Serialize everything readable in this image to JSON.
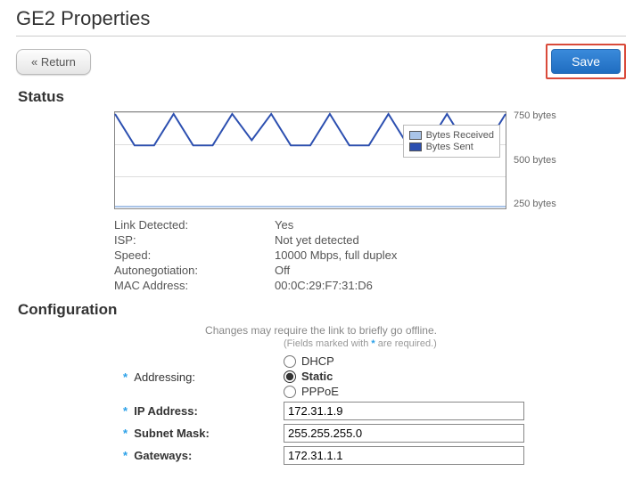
{
  "page": {
    "title": "GE2 Properties"
  },
  "toolbar": {
    "return_label": "« Return",
    "save_label": "Save"
  },
  "sections": {
    "status": "Status",
    "configuration": "Configuration"
  },
  "status": {
    "link_detected": {
      "label": "Link Detected:",
      "value": "Yes"
    },
    "isp": {
      "label": "ISP:",
      "value": "Not yet detected"
    },
    "speed": {
      "label": "Speed:",
      "value": "10000 Mbps, full duplex"
    },
    "autoneg": {
      "label": "Autonegotiation:",
      "value": "Off"
    },
    "mac": {
      "label": "MAC Address:",
      "value": "00:0C:29:F7:31:D6"
    }
  },
  "chart_data": {
    "type": "line",
    "ylim": [
      0,
      750
    ],
    "grid_y": [
      250,
      500,
      750
    ],
    "ylabels": [
      "750 bytes",
      "500 bytes",
      "250 bytes"
    ],
    "legend": [
      {
        "name": "Bytes Received",
        "color": "#a9c4e8"
      },
      {
        "name": "Bytes Sent",
        "color": "#2c4fb0"
      }
    ],
    "series": [
      {
        "name": "Bytes Received",
        "color": "#a9c4e8",
        "values": [
          0,
          0,
          0,
          0,
          0,
          0,
          0,
          0,
          0,
          0,
          0,
          0,
          0,
          0,
          0,
          0,
          0,
          0,
          0,
          0,
          0
        ]
      },
      {
        "name": "Bytes Sent",
        "color": "#2c4fb0",
        "values": [
          750,
          500,
          500,
          750,
          500,
          500,
          750,
          550,
          750,
          500,
          500,
          750,
          500,
          500,
          750,
          500,
          500,
          750,
          500,
          500,
          750
        ]
      }
    ]
  },
  "config": {
    "changes_note": "Changes may require the link to briefly go offline.",
    "required_note_pre": "(Fields marked with ",
    "required_note_post": " are required.)",
    "addressing": {
      "label": "Addressing:",
      "options": {
        "dhcp": "DHCP",
        "static": "Static",
        "pppoe": "PPPoE"
      },
      "selected": "static"
    },
    "ip_address": {
      "label": "IP Address:",
      "value": "172.31.1.9"
    },
    "subnet_mask": {
      "label": "Subnet Mask:",
      "value": "255.255.255.0"
    },
    "gateways": {
      "label": "Gateways:",
      "value": "172.31.1.1"
    }
  },
  "glyphs": {
    "asterisk": "*"
  }
}
